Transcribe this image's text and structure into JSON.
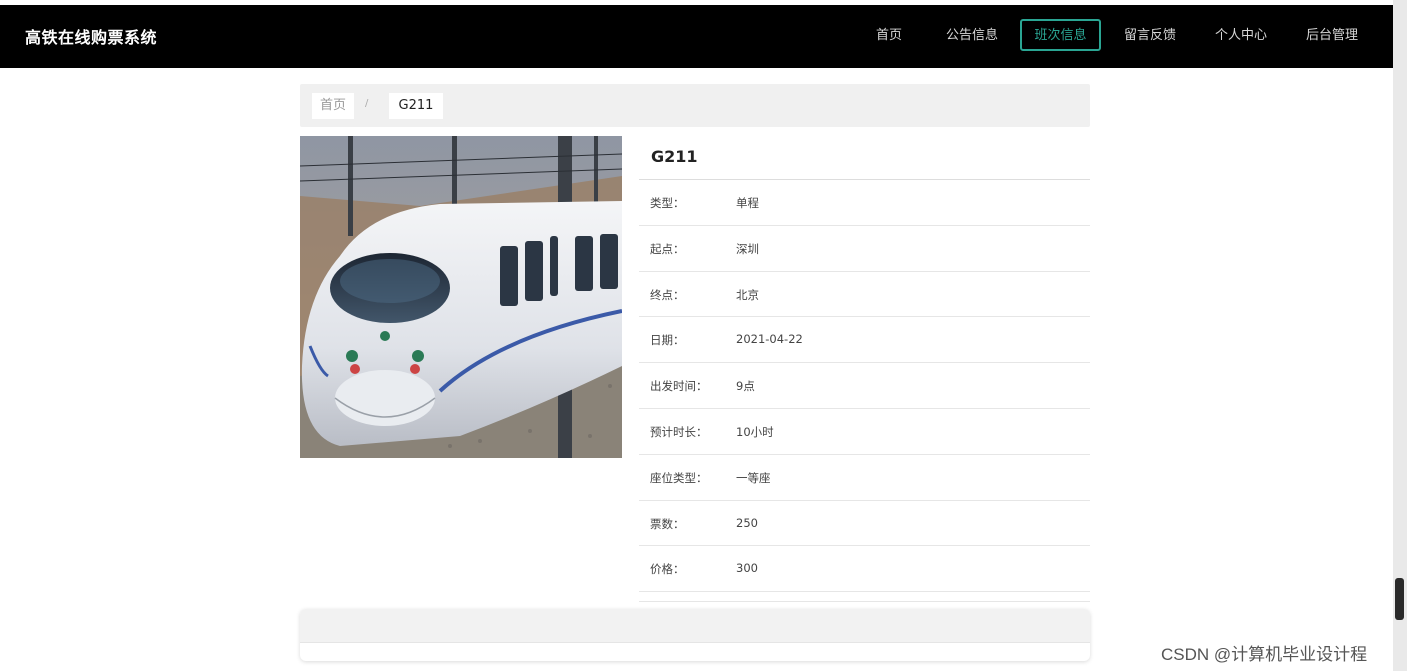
{
  "app": {
    "title": "高铁在线购票系统"
  },
  "nav": {
    "items": [
      {
        "label": "首页",
        "active": false
      },
      {
        "label": "公告信息",
        "active": false
      },
      {
        "label": "班次信息",
        "active": true
      },
      {
        "label": "留言反馈",
        "active": false
      },
      {
        "label": "个人中心",
        "active": false
      },
      {
        "label": "后台管理",
        "active": false
      }
    ],
    "accent_color": "#2aa593"
  },
  "breadcrumb": {
    "home": "首页",
    "separator": "/",
    "current": "G211"
  },
  "train": {
    "name": "G211",
    "fields": [
      {
        "label": "类型：",
        "value": "单程"
      },
      {
        "label": "起点：",
        "value": "深圳"
      },
      {
        "label": "终点：",
        "value": "北京"
      },
      {
        "label": "日期：",
        "value": "2021-04-22"
      },
      {
        "label": "出发时间：",
        "value": "9点"
      },
      {
        "label": "预计时长：",
        "value": "10小时"
      },
      {
        "label": "座位类型：",
        "value": "一等座"
      },
      {
        "label": "票数：",
        "value": "250"
      },
      {
        "label": "价格：",
        "value": "300"
      }
    ]
  },
  "watermark": "CSDN @计算机毕业设计程"
}
